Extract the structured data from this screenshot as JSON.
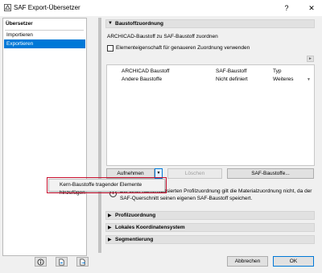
{
  "window": {
    "title": "SAF Export-Übersetzer",
    "help_glyph": "?",
    "close_glyph": "✕"
  },
  "sidebar": {
    "heading": "Übersetzer",
    "items": [
      {
        "label": "Importieren",
        "active": false
      },
      {
        "label": "Exportieren",
        "active": true
      }
    ]
  },
  "sections": {
    "baustoff": {
      "title": "Baustoffzuordnung",
      "expanded": true,
      "subtitle": "ARCHICAD-Baustoff zu SAF-Baustoff zuordnen",
      "checkbox_label": "Elementeigenschaft für genaueren Zuordnung verwenden",
      "checkbox_checked": false
    },
    "profil": {
      "title": "Profilzuordnung",
      "expanded": false
    },
    "koordinaten": {
      "title": "Lokales Koordinatensystem",
      "expanded": false
    },
    "segmentierung": {
      "title": "Segmentierung",
      "expanded": false
    }
  },
  "table": {
    "columns": [
      "ARCHICAD Baustoff",
      "SAF-Baustoff",
      "Typ"
    ],
    "rows": [
      [
        "Andere Baustoffe",
        "Nicht definiert",
        "Weiteres"
      ]
    ]
  },
  "buttons": {
    "add": "Aufnehmen",
    "delete": "Löschen",
    "saf_materials": "SAF-Baustoffe...",
    "cancel": "Abbrechen",
    "ok": "OK"
  },
  "dropdown_menu": {
    "items": [
      "Kern-Baustoffe tragender Elemente hinzufügen"
    ]
  },
  "info": {
    "text": "Bei einer namensbasierten Profilzuordnung gilt die Materialzuordnung nicht, da der SAF-Querschnitt seinen eigenen SAF-Baustoff speichert."
  },
  "colors": {
    "accent": "#0078d7",
    "highlight_border": "#c8102e"
  }
}
